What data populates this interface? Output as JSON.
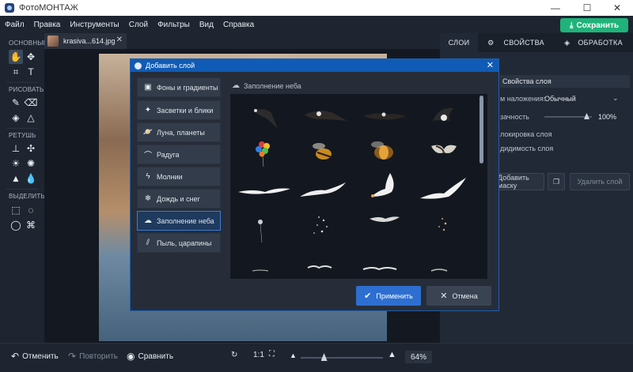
{
  "app": {
    "title": "ФотоМОНТАЖ",
    "window_controls": [
      "—",
      "☐",
      "✕"
    ]
  },
  "menu": [
    "Файл",
    "Правка",
    "Инструменты",
    "Слой",
    "Фильтры",
    "Вид",
    "Справка"
  ],
  "save_label": "Сохранить",
  "toolbox": {
    "sections": [
      "ОСНОВНЫЕ",
      "РИСОВАТЬ",
      "РЕТУШЬ",
      "ВЫДЕЛИТЬ"
    ]
  },
  "file_tab": {
    "name": "krasiva...614.jpg"
  },
  "right_panel": {
    "tabs": [
      "СЛОИ",
      "СВОЙСТВА",
      "ОБРАБОТКА"
    ],
    "layer_props_title": "Свойства слоя",
    "blend_label": "м наложения:",
    "blend_value": "Обычный",
    "opacity_label": "зачность",
    "opacity_value": "100%",
    "lock_label": "локировка слоя",
    "visibility_label": "дидимость слоя",
    "add_mask_label": "Добавить маску",
    "delete_layer_label": "Удалить слой"
  },
  "bottom": {
    "undo": "Отменить",
    "redo": "Повторить",
    "compare": "Сравнить",
    "ratio": "1:1",
    "zoom": "64%"
  },
  "dialog": {
    "title": "Добавить слой",
    "categories": [
      {
        "label": "Фоны и градиенты",
        "icon": "image-icon"
      },
      {
        "label": "Засветки и блики",
        "icon": "sparkle-icon"
      },
      {
        "label": "Луна, планеты",
        "icon": "planet-icon"
      },
      {
        "label": "Радуга",
        "icon": "rainbow-icon"
      },
      {
        "label": "Молнии",
        "icon": "lightning-icon"
      },
      {
        "label": "Дождь и снег",
        "icon": "snowflake-icon"
      },
      {
        "label": "Заполнение неба",
        "icon": "cloud-icon"
      },
      {
        "label": "Пыль, царапины",
        "icon": "scratch-icon"
      }
    ],
    "selected_category": "Заполнение неба",
    "gallery_title": "Заполнение неба",
    "apply_label": "Применить",
    "cancel_label": "Отмена"
  }
}
